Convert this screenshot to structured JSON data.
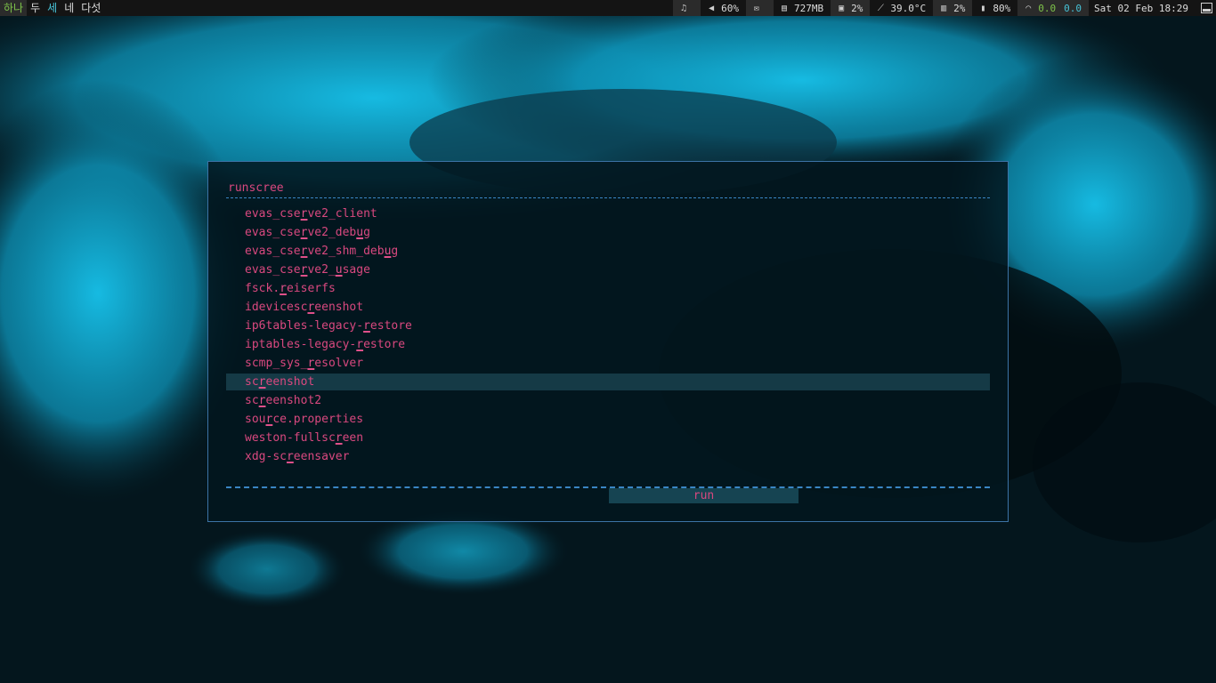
{
  "workspaces": [
    "하나",
    "두",
    "세",
    "네",
    "다섯"
  ],
  "status": {
    "music_icon": "music-note-icon",
    "volume": "60%",
    "mail_icon": "mail-icon",
    "memory": "727MB",
    "cpu": "2%",
    "temperature": "39.0°C",
    "disk": "2%",
    "battery": "80%",
    "net_down": "0.0",
    "net_up": "0.0",
    "clock": "Sat 02 Feb 18:29"
  },
  "launcher": {
    "query": "runscree",
    "items": [
      "evas_cserve2_client",
      "evas_cserve2_debug",
      "evas_cserve2_shm_debug",
      "evas_cserve2_usage",
      "fsck.reiserfs",
      "idevicescreenshot",
      "ip6tables-legacy-restore",
      "iptables-legacy-restore",
      "scmp_sys_resolver",
      "screenshot",
      "screenshot2",
      "source.properties",
      "weston-fullscreen",
      "xdg-screensaver"
    ],
    "selected_index": 9,
    "run_label": "run"
  },
  "colors": {
    "accent_text": "#d9487f",
    "border": "#3c73a6",
    "selection": "#153a46",
    "workspace_active": "#7ec34a"
  }
}
